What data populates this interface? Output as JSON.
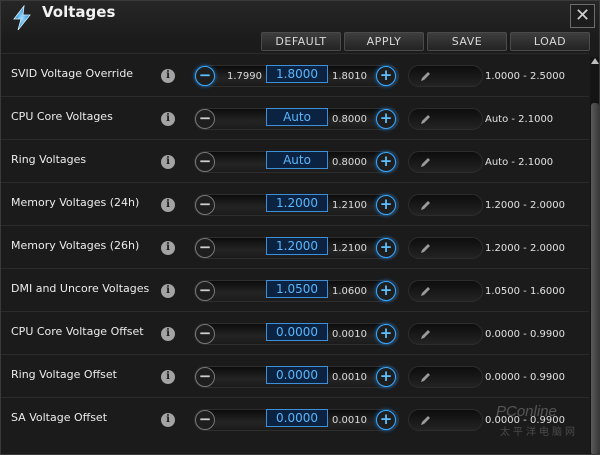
{
  "window": {
    "title": "Voltages",
    "close_glyph": "✕",
    "accent": "#3aa8ff"
  },
  "toolbar": {
    "default_label": "DEFAULT",
    "apply_label": "APPLY",
    "save_label": "SAVE",
    "load_label": "LOAD"
  },
  "icons": {
    "info_glyph": "i",
    "minus_glyph": "−",
    "plus_glyph": "+"
  },
  "rows": [
    {
      "label": "SVID Voltage Override",
      "low": "1.7990",
      "current": "1.8000",
      "high": "1.8010",
      "range": "1.0000 - 2.5000"
    },
    {
      "label": "CPU Core Voltages",
      "low": "",
      "current": "Auto",
      "high": "0.8000",
      "range": "Auto - 2.1000"
    },
    {
      "label": "Ring Voltages",
      "low": "",
      "current": "Auto",
      "high": "0.8000",
      "range": "Auto - 2.1000"
    },
    {
      "label": "Memory Voltages (24h)",
      "low": "",
      "current": "1.2000",
      "high": "1.2100",
      "range": "1.2000 - 2.0000"
    },
    {
      "label": "Memory Voltages (26h)",
      "low": "",
      "current": "1.2000",
      "high": "1.2100",
      "range": "1.2000 - 2.0000"
    },
    {
      "label": "DMI and Uncore Voltages",
      "low": "",
      "current": "1.0500",
      "high": "1.0600",
      "range": "1.0500 - 1.6000"
    },
    {
      "label": "CPU Core Voltage Offset",
      "low": "",
      "current": "0.0000",
      "high": "0.0010",
      "range": "0.0000 - 0.9900"
    },
    {
      "label": "Ring Voltage Offset",
      "low": "",
      "current": "0.0000",
      "high": "0.0010",
      "range": "0.0000 - 0.9900"
    },
    {
      "label": "SA Voltage Offset",
      "low": "",
      "current": "0.0000",
      "high": "0.0010",
      "range": "0.0000 - 0.9900"
    }
  ],
  "watermark": {
    "logo": "PConline",
    "sub": "太平洋电脑网"
  }
}
